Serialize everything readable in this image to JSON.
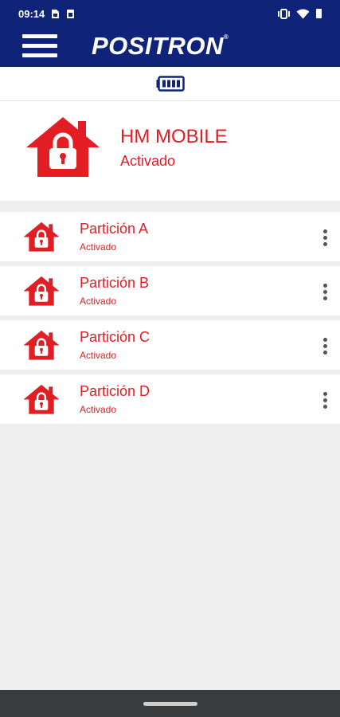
{
  "status_bar": {
    "time": "09:14",
    "left_icons": [
      "sim-card-icon",
      "sd-card-icon"
    ],
    "right_icons": [
      "vibrate-icon",
      "wifi-icon",
      "cell-signal-icon"
    ]
  },
  "app_bar": {
    "menu_icon": "hamburger-menu-icon",
    "brand": "POSITRON",
    "brand_mark": "®"
  },
  "device_battery_icon": "battery-icon",
  "device": {
    "name": "HM MOBILE",
    "status": "Activado",
    "icon": "house-lock-icon"
  },
  "partitions": [
    {
      "name": "Partición A",
      "status": "Activado"
    },
    {
      "name": "Partición B",
      "status": "Activado"
    },
    {
      "name": "Partición C",
      "status": "Activado"
    },
    {
      "name": "Partición D",
      "status": "Activado"
    }
  ],
  "colors": {
    "primary": "#0f2479",
    "accent": "#e31d24",
    "background": "#eeeeee"
  }
}
